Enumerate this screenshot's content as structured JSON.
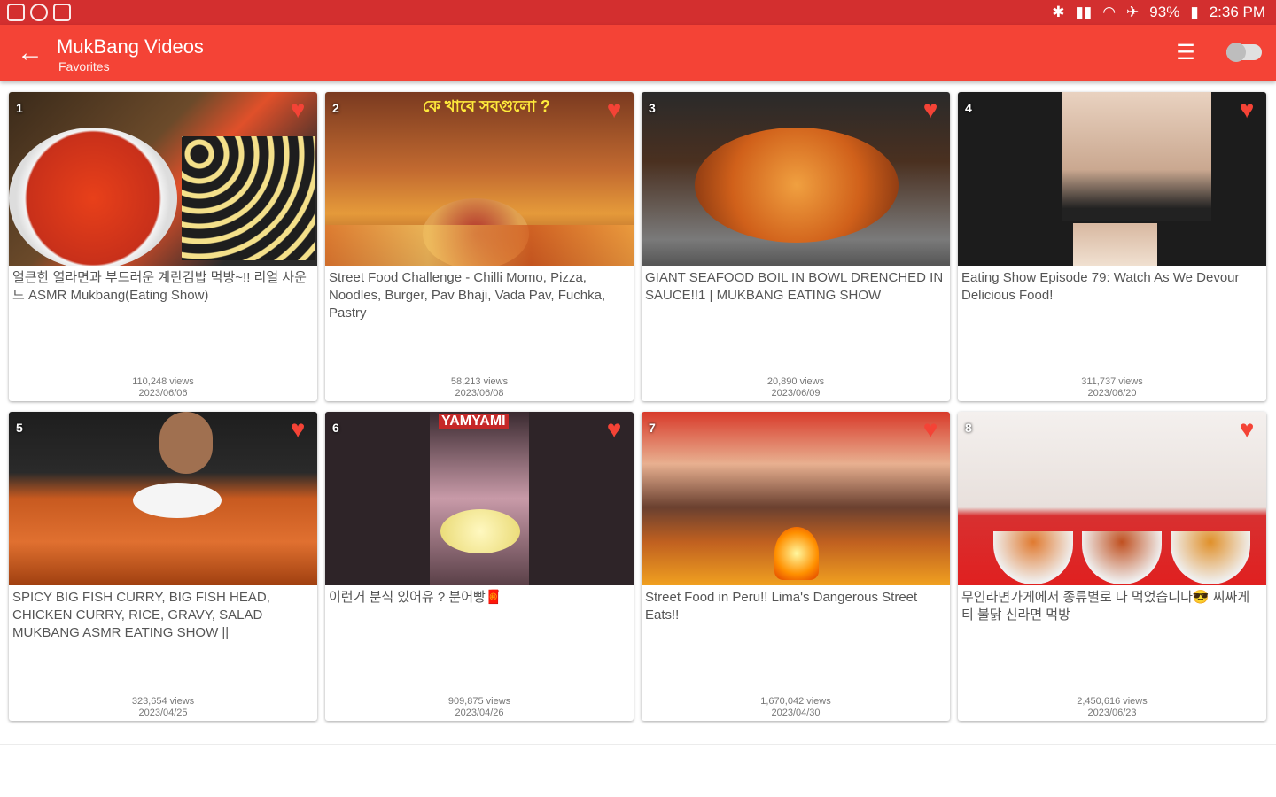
{
  "status": {
    "battery": "93%",
    "time": "2:36 PM"
  },
  "appbar": {
    "title": "MukBang Videos",
    "subtitle": "Favorites",
    "back_icon": "arrow-left-icon",
    "search_icon": "list-search-icon"
  },
  "colors": {
    "appbar": "#f44336",
    "statusbar": "#d32f2f",
    "heart": "#f44336"
  },
  "videos": [
    {
      "num": "1",
      "title": "얼큰한 열라면과 부드러운 계란김밥 먹방~!! 리얼 사운드 ASMR Mukbang(Eating Show)",
      "views": "110,248 views",
      "date": "2023/06/06",
      "thumb_text": ""
    },
    {
      "num": "2",
      "title": "Street Food Challenge - Chilli Momo, Pizza, Noodles, Burger, Pav Bhaji, Vada Pav, Fuchka, Pastry",
      "views": "58,213 views",
      "date": "2023/06/08",
      "thumb_text": "কে খাবে সবগুলো ?"
    },
    {
      "num": "3",
      "title": "GIANT SEAFOOD BOIL IN BOWL DRENCHED IN SAUCE!!1 | MUKBANG EATING SHOW",
      "views": "20,890 views",
      "date": "2023/06/09",
      "thumb_text": ""
    },
    {
      "num": "4",
      "title": "Eating Show Episode 79: Watch As We Devour Delicious Food!",
      "views": "311,737 views",
      "date": "2023/06/20",
      "thumb_text": ""
    },
    {
      "num": "5",
      "title": "SPICY BIG FISH CURRY, BIG FISH HEAD, CHICKEN CURRY, RICE, GRAVY, SALAD MUKBANG ASMR EATING SHOW ||",
      "views": "323,654 views",
      "date": "2023/04/25",
      "thumb_text": ""
    },
    {
      "num": "6",
      "title": "이런거 분식 있어유 ? 분어빵🧧",
      "views": "909,875 views",
      "date": "2023/04/26",
      "thumb_text": "YAMYAMI"
    },
    {
      "num": "7",
      "title": "Street Food in Peru!! Lima's Dangerous Street Eats!!",
      "views": "1,670,042 views",
      "date": "2023/04/30",
      "thumb_text": ""
    },
    {
      "num": "8",
      "title": "무인라면가게에서 종류별로 다 먹었습니다😎 찌짜게티 불닭 신라면 먹방",
      "views": "2,450,616 views",
      "date": "2023/06/23",
      "thumb_text": ""
    }
  ]
}
